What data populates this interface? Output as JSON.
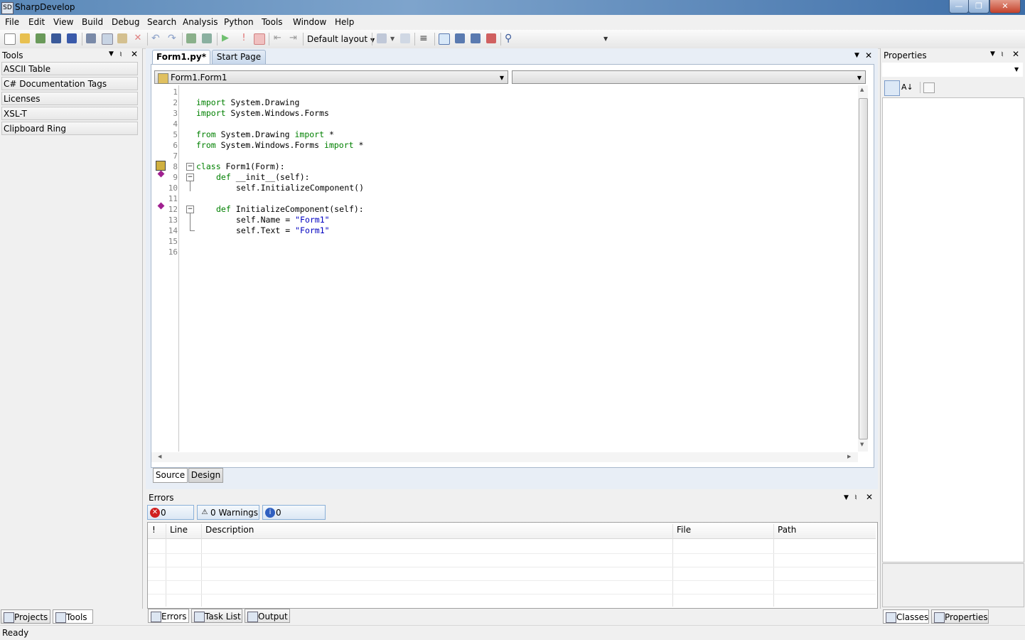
{
  "window": {
    "title": "SharpDevelop",
    "icon_text": "SD"
  },
  "menu": [
    "File",
    "Edit",
    "View",
    "Build",
    "Debug",
    "Search",
    "Analysis",
    "Python",
    "Tools",
    "Window",
    "Help"
  ],
  "toolbar": {
    "layout_label": "Default layout"
  },
  "tools_pad": {
    "title": "Tools",
    "items": [
      "ASCII Table",
      "C# Documentation Tags",
      "Licenses",
      "XSL-T",
      "Clipboard Ring"
    ],
    "tabs": [
      "Projects",
      "Tools"
    ]
  },
  "editor": {
    "tabs": [
      "Form1.py*",
      "Start Page"
    ],
    "class_combo": "Form1.Form1",
    "member_combo": "",
    "line_numbers": [
      "1",
      "2",
      "3",
      "4",
      "5",
      "6",
      "7",
      "8",
      "9",
      "10",
      "11",
      "12",
      "13",
      "14",
      "15",
      "16"
    ],
    "code": {
      "l2_kw": "import",
      "l2_rest": " System.Drawing",
      "l3_kw": "import",
      "l3_rest": " System.Windows.Forms",
      "l5_kw1": "from",
      "l5_mid": " System.Drawing ",
      "l5_kw2": "import",
      "l5_rest": " *",
      "l6_kw1": "from",
      "l6_mid": " System.Windows.Forms ",
      "l6_kw2": "import",
      "l6_rest": " *",
      "l8_kw": "class",
      "l8_rest": " Form1(Form):",
      "l9_kw": "def",
      "l9_rest": " __init__(self):",
      "l10": "self.InitializeComponent()",
      "l12_kw": "def",
      "l12_rest": " InitializeComponent(self):",
      "l13_a": "self.Name = ",
      "l13_str": "\"Form1\"",
      "l14_a": "self.Text = ",
      "l14_str": "\"Form1\""
    },
    "view_tabs": [
      "Source",
      "Design"
    ]
  },
  "errors_pad": {
    "title": "Errors",
    "filters": [
      "0 Errors",
      "0 Warnings",
      "0 Messages"
    ],
    "columns": [
      "!",
      "Line",
      "Description",
      "File",
      "Path"
    ],
    "tabs": [
      "Errors",
      "Task List",
      "Output"
    ]
  },
  "properties_pad": {
    "title": "Properties",
    "tabs": [
      "Classes",
      "Properties"
    ]
  },
  "status": {
    "text": "Ready"
  },
  "colors": {
    "keyword": "#008000",
    "string": "#0000c0",
    "title_bar": "#5a88b8"
  }
}
